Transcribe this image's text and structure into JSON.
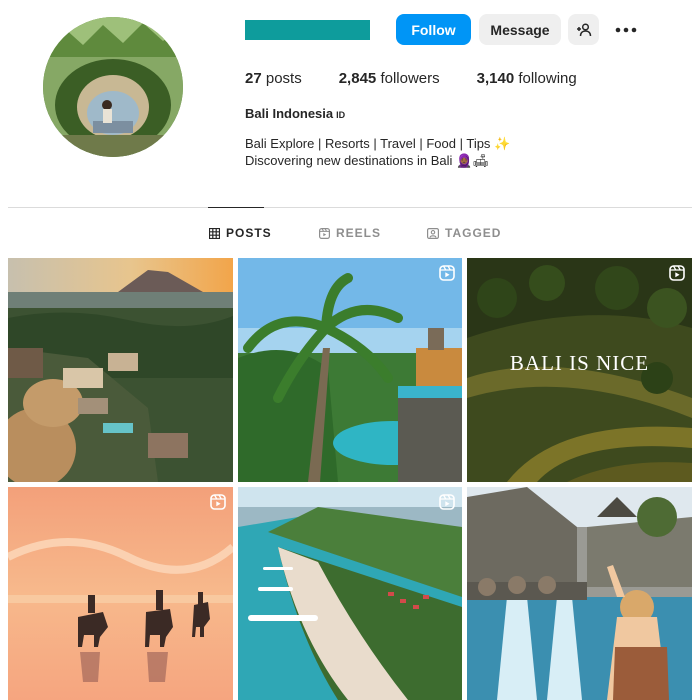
{
  "profile": {
    "follow_label": "Follow",
    "message_label": "Message",
    "stats": {
      "posts_count": "27",
      "posts_label": "posts",
      "followers_count": "2,845",
      "followers_label": "followers",
      "following_count": "3,140",
      "following_label": "following"
    },
    "full_name": "Bali Indonesia",
    "full_name_suffix": "ID",
    "bio_line1": "Bali Explore | Resorts | Travel | Food | Tips ✨",
    "bio_line2": "Discovering new destinations in Bali 🧕🏾🛋"
  },
  "tabs": [
    {
      "label": "POSTS",
      "active": true
    },
    {
      "label": "REELS",
      "active": false
    },
    {
      "label": "TAGGED",
      "active": false
    }
  ],
  "posts": [
    {
      "is_reel": false,
      "scene": "jungle resort at sunset with mountain"
    },
    {
      "is_reel": true,
      "scene": "palm trees over infinity pool"
    },
    {
      "is_reel": true,
      "scene": "rice terraces",
      "overlay_text": "BALI IS NICE"
    },
    {
      "is_reel": true,
      "scene": "horse riders on beach at sunset"
    },
    {
      "is_reel": true,
      "scene": "turquoise beach with boats"
    },
    {
      "is_reel": false,
      "scene": "woman at water temple fountains"
    }
  ],
  "colors": {
    "follow_blue": "#0095f6",
    "username_teal": "#0e9c9c",
    "button_grey": "#efefef"
  }
}
